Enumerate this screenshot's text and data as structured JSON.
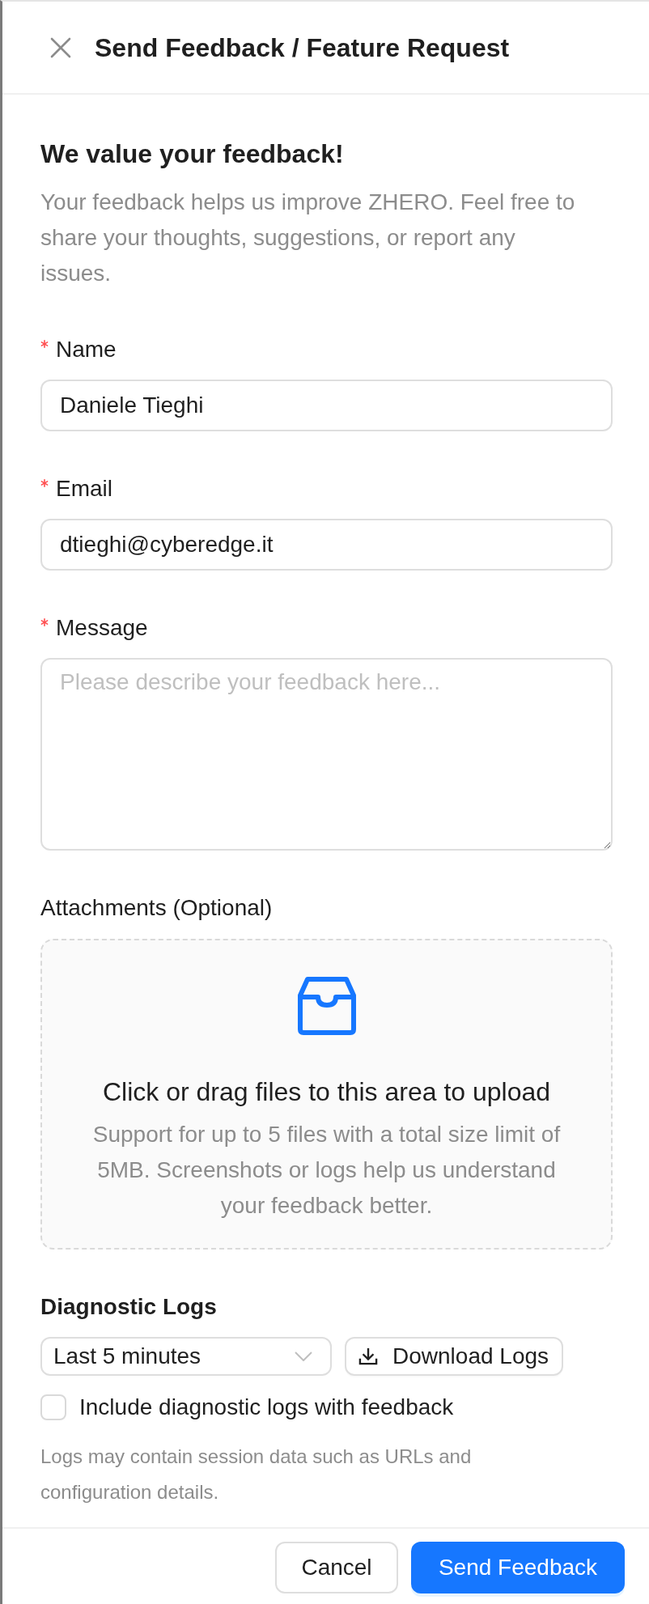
{
  "drawer": {
    "title": "Send Feedback / Feature Request"
  },
  "intro": {
    "heading": "We value your feedback!",
    "text": "Your feedback helps us improve ZHERO. Feel free to share your thoughts, suggestions, or report any issues."
  },
  "fields": [
    {
      "kind": "input",
      "label": "Name",
      "required": true,
      "value": "Daniele Tieghi"
    },
    {
      "kind": "input",
      "label": "Email",
      "required": true,
      "value": "dtieghi@cyberedge.it"
    },
    {
      "kind": "textarea",
      "label": "Message",
      "required": true,
      "placeholder": "Please describe your feedback here..."
    }
  ],
  "attachments": {
    "label": "Attachments (Optional)",
    "title": "Click or drag files to this area to upload",
    "hint": "Support for up to 5 files with a total size limit of 5MB. Screenshots or logs help us understand your feedback better."
  },
  "diagnostic_logs": {
    "heading": "Diagnostic Logs",
    "range": "Last 5 minutes",
    "download_button": "Download Logs",
    "include": {
      "label": "Include diagnostic logs with feedback",
      "checked": false
    },
    "note": "Logs may contain session data such as URLs and configuration details."
  },
  "footer": {
    "buttons": [
      {
        "label": "Cancel",
        "kind": "default"
      },
      {
        "label": "Send Feedback",
        "kind": "primary"
      }
    ]
  }
}
